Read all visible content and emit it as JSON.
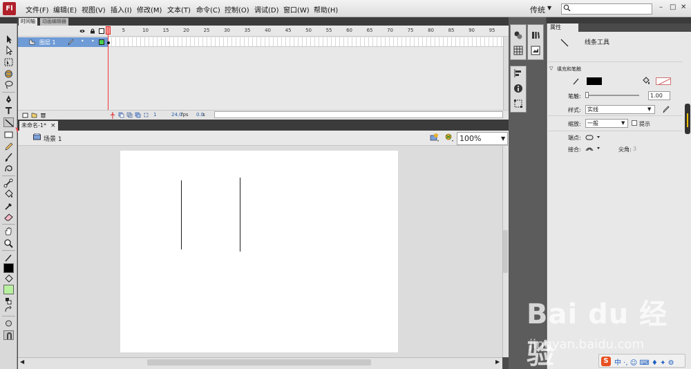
{
  "app": {
    "logo_text": "Fl"
  },
  "menu": [
    "文件(F)",
    "编辑(E)",
    "视图(V)",
    "插入(I)",
    "修改(M)",
    "文本(T)",
    "命令(C)",
    "控制(O)",
    "调试(D)",
    "窗口(W)",
    "帮助(H)"
  ],
  "workspace": {
    "label": "传统"
  },
  "search": {
    "placeholder": ""
  },
  "window_controls": {
    "minimize": "–",
    "maximize": "□",
    "close": "✕"
  },
  "timeline": {
    "tabs": [
      "时间轴",
      "动画编辑器"
    ],
    "frame_numbers": [
      "1",
      "5",
      "10",
      "15",
      "20",
      "25",
      "30",
      "35",
      "40",
      "45",
      "50",
      "55",
      "60",
      "65",
      "70",
      "75",
      "80",
      "85",
      "90",
      "95"
    ],
    "layer": {
      "name": "图层 1"
    },
    "status": {
      "current_frame": "1",
      "fps": "24.0",
      "fps_unit": "fps",
      "time": "0.0",
      "time_unit": "s"
    }
  },
  "document": {
    "tab_title": "未命名-1*",
    "tab_close": "×",
    "scene_label": "场景 1",
    "zoom": "100%"
  },
  "properties": {
    "tab_label": "属性",
    "tool_name": "线条工具",
    "section_fill_stroke": "填充和笔触",
    "stroke_label": "笔触:",
    "stroke_value": "1.00",
    "style_label": "样式:",
    "style_value": "实线",
    "scale_label": "缩放:",
    "scale_value": "一般",
    "hint_label": "提示",
    "cap_label": "端点:",
    "join_label": "接合:",
    "miter_label": "尖角:",
    "miter_value": "3",
    "stroke_color": "#000000",
    "fill_color": "none"
  },
  "watermark": {
    "logo": "Bai du 经验",
    "url": "jingyan.baidu.com"
  },
  "ime": {
    "text": "中 ·, ☺ ⌨ ♦ ✦ ⚙"
  }
}
